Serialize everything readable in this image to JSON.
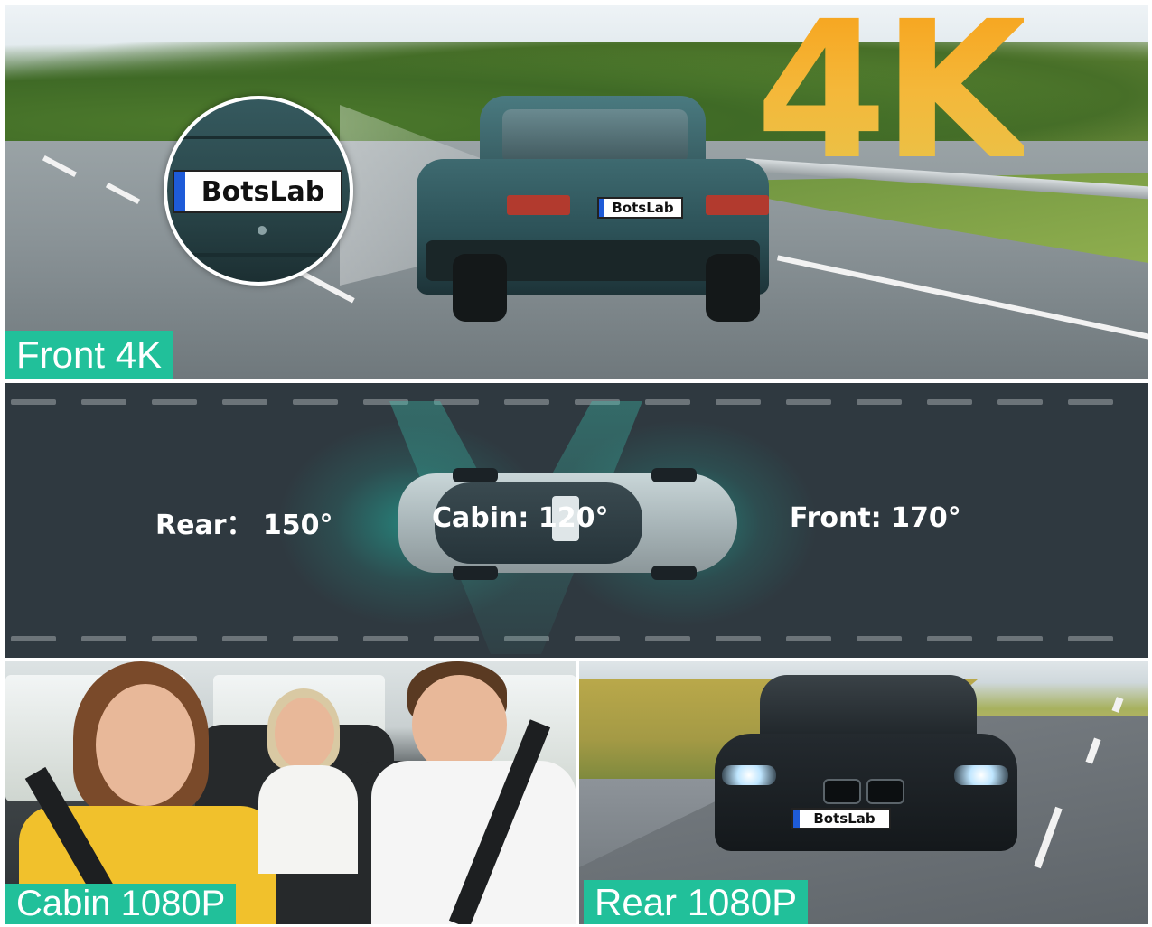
{
  "front": {
    "headline": "4K",
    "label": "Front 4K",
    "plate_text": "BotsLab",
    "magnifier_plate_text": "BotsLab"
  },
  "fov": {
    "rear_text": "Rear：  150°",
    "cabin_text": "Cabin: 120°",
    "front_text": "Front:  170°",
    "accent_color": "#21c09a"
  },
  "cabin": {
    "label": "Cabin 1080P"
  },
  "rear": {
    "label": "Rear 1080P",
    "plate_text": "BotsLab"
  },
  "colors": {
    "label_bg": "#21c09a",
    "headline_gradient": [
      "#f7a21b",
      "#e8c44a"
    ],
    "fov_bg": "#2f3940"
  }
}
